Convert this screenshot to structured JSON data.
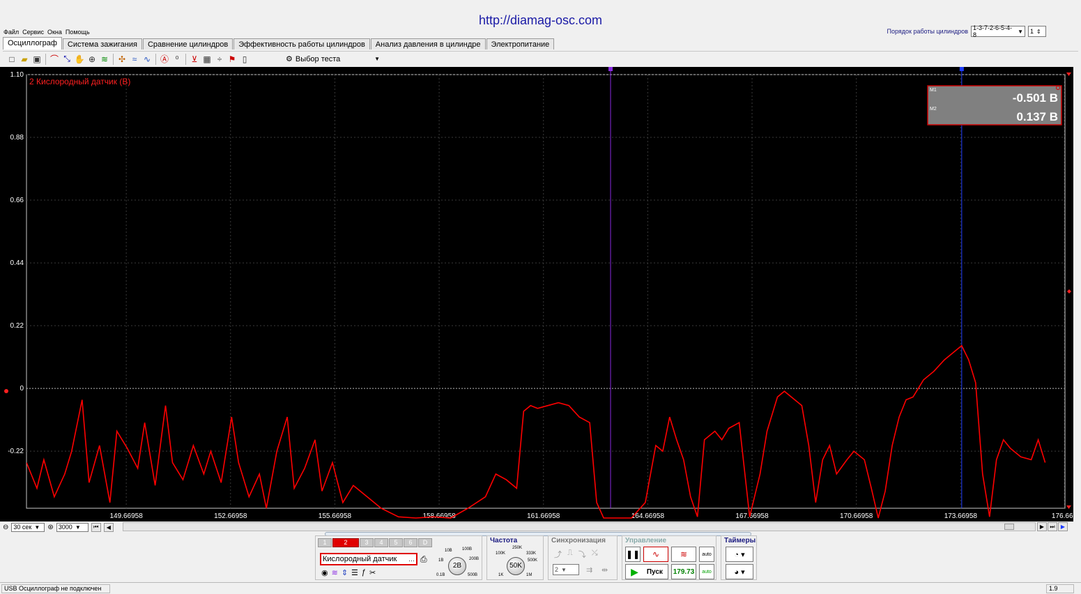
{
  "header": {
    "url": "http://diamag-osc.com"
  },
  "menu": [
    "Файл",
    "Сервис",
    "Окна",
    "Помощь"
  ],
  "firing_order": {
    "label": "Порядок работы цилиндров",
    "value": "1-3-7-2-6-5-4-8",
    "cylinder": "1"
  },
  "tabs": [
    "Осциллограф",
    "Система зажигания",
    "Сравнение цилиндров",
    "Эффективность работы цилиндров",
    "Анализ давления в цилиндре",
    "Электропитание"
  ],
  "active_tab": 0,
  "toolbar": {
    "test_select": "Выбор теста"
  },
  "chart_data": {
    "type": "line",
    "title": "2 Кислородный датчик (В)",
    "y_tick_labels": [
      "1.10",
      "0.88",
      "0.66",
      "0.44",
      "0.22",
      "0",
      "-0.22"
    ],
    "x_tick_labels": [
      "149.66958",
      "152.66958",
      "155.66958",
      "158.66958",
      "161.66958",
      "164.66958",
      "167.66958",
      "170.66958",
      "173.66958",
      "176.669"
    ],
    "ylim": [
      -0.42,
      1.1
    ],
    "xlim": [
      146.8,
      176.67
    ],
    "grid": true,
    "color": "#ff0000",
    "markers": [
      {
        "name": "M1",
        "x": 163.6,
        "color": "#8a2be2"
      },
      {
        "name": "M2",
        "x": 173.7,
        "color": "#1e3cff"
      }
    ],
    "readout": {
      "m1_label": "M1",
      "m1_value": "-0.501 В",
      "m2_label": "M2",
      "m2_value": "0.137 В"
    },
    "series": [
      {
        "x": [
          146.8,
          147.1,
          147.3,
          147.6,
          147.9,
          148.1,
          148.4,
          148.6,
          148.9,
          149.2,
          149.4,
          149.7,
          150.0,
          150.2,
          150.5,
          150.8,
          151.0,
          151.3,
          151.6,
          151.9,
          152.1,
          152.4,
          152.7,
          152.9,
          153.2,
          153.5,
          153.7,
          154.0,
          154.3,
          154.5,
          154.8,
          155.1,
          155.3,
          155.6,
          155.9,
          156.2,
          156.6,
          157.0,
          157.5,
          158.0,
          158.5,
          159.0,
          159.5,
          160.0,
          160.3,
          160.6,
          160.9,
          161.1,
          161.3,
          161.5,
          161.8,
          162.1,
          162.4,
          162.7,
          163.0,
          163.2,
          163.4,
          163.7,
          164.2,
          164.6,
          164.9,
          165.1,
          165.3,
          165.5,
          165.7,
          165.9,
          166.1,
          166.3,
          166.6,
          166.8,
          167.0,
          167.3,
          167.6,
          167.9,
          168.1,
          168.4,
          168.6,
          168.9,
          169.1,
          169.3,
          169.5,
          169.7,
          169.9,
          170.1,
          170.4,
          170.6,
          170.9,
          171.1,
          171.3,
          171.5,
          171.7,
          171.9,
          172.1,
          172.3,
          172.6,
          172.9,
          173.2,
          173.5,
          173.7,
          173.9,
          174.1,
          174.3,
          174.5,
          174.7,
          174.9,
          175.1,
          175.4,
          175.7,
          175.9,
          176.1
        ],
        "y": [
          -0.26,
          -0.35,
          -0.25,
          -0.38,
          -0.3,
          -0.22,
          -0.04,
          -0.33,
          -0.2,
          -0.4,
          -0.15,
          -0.21,
          -0.28,
          -0.12,
          -0.34,
          -0.06,
          -0.26,
          -0.32,
          -0.2,
          -0.3,
          -0.22,
          -0.33,
          -0.1,
          -0.26,
          -0.38,
          -0.3,
          -0.42,
          -0.22,
          -0.1,
          -0.35,
          -0.28,
          -0.18,
          -0.36,
          -0.26,
          -0.4,
          -0.34,
          -0.38,
          -0.42,
          -0.45,
          -0.48,
          -0.45,
          -0.47,
          -0.42,
          -0.38,
          -0.3,
          -0.32,
          -0.35,
          -0.08,
          -0.06,
          -0.07,
          -0.06,
          -0.05,
          -0.06,
          -0.1,
          -0.12,
          -0.4,
          -0.55,
          -0.5,
          -0.52,
          -0.4,
          -0.2,
          -0.22,
          -0.1,
          -0.18,
          -0.25,
          -0.38,
          -0.45,
          -0.18,
          -0.15,
          -0.18,
          -0.14,
          -0.12,
          -0.45,
          -0.3,
          -0.15,
          -0.03,
          -0.01,
          -0.04,
          -0.06,
          -0.2,
          -0.4,
          -0.25,
          -0.2,
          -0.3,
          -0.25,
          -0.22,
          -0.25,
          -0.35,
          -0.46,
          -0.36,
          -0.2,
          -0.1,
          -0.04,
          -0.03,
          0.03,
          0.06,
          0.1,
          0.13,
          0.15,
          0.1,
          0.02,
          -0.3,
          -0.45,
          -0.25,
          -0.18,
          -0.21,
          -0.24,
          -0.25,
          -0.18,
          -0.26
        ]
      }
    ]
  },
  "scale_bar": {
    "time_window": "30 сек",
    "points": "3000"
  },
  "control_panel": {
    "channels": [
      "1",
      "2",
      "3",
      "4",
      "5",
      "6",
      "D"
    ],
    "active_channel": 1,
    "channel_name": "Кислородный датчик",
    "volts_knob": {
      "value": "2В",
      "labels": [
        "10В",
        "100В",
        "1В",
        "200В",
        "0.1В",
        "500В"
      ]
    },
    "freq_title": "Частота",
    "freq_knob": {
      "value": "50K",
      "labels": [
        "250K",
        "100K",
        "333K",
        "500K",
        "1K",
        "1M"
      ]
    },
    "sync_title": "Синхронизация",
    "sync_value": "2",
    "control_title": "Управление",
    "start_label": "Пуск",
    "rate_value": "179.73",
    "timers_title": "Таймеры"
  },
  "statusbar": {
    "left": "USB Осциллограф не подключен",
    "right": "1.9"
  }
}
